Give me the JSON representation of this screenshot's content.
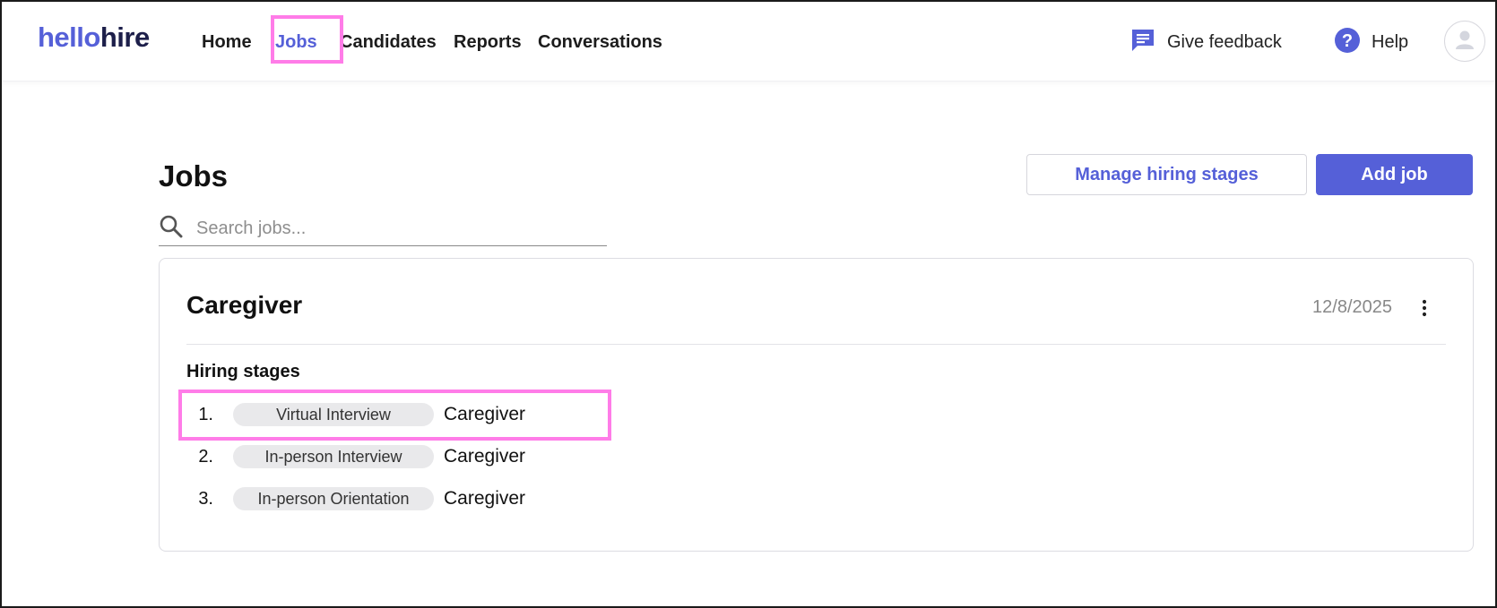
{
  "brand": {
    "part1": "hello",
    "part2": "hire",
    "colors": {
      "primary": "#5560d8",
      "dark": "#1d1f4a"
    }
  },
  "nav": {
    "items": [
      {
        "label": "Home",
        "active": false
      },
      {
        "label": "Jobs",
        "active": true
      },
      {
        "label": "Candidates",
        "active": false
      },
      {
        "label": "Reports",
        "active": false
      },
      {
        "label": "Conversations",
        "active": false
      }
    ],
    "feedback": {
      "label": "Give feedback",
      "icon": "chat-bubble-icon"
    },
    "help": {
      "label": "Help",
      "icon": "question-circle-icon"
    },
    "avatar": {
      "icon": "user-avatar-icon"
    }
  },
  "page": {
    "title": "Jobs",
    "manage_button": "Manage hiring stages",
    "add_button": "Add job",
    "search": {
      "placeholder": "Search jobs...",
      "value": "",
      "icon": "search-icon"
    }
  },
  "jobs": [
    {
      "title": "Caregiver",
      "date": "12/8/2025",
      "menu_icon": "more-vertical-icon",
      "stages_heading": "Hiring stages",
      "stages": [
        {
          "number": "1.",
          "stage": "Virtual Interview",
          "job": "Caregiver"
        },
        {
          "number": "2.",
          "stage": "In-person Interview",
          "job": "Caregiver"
        },
        {
          "number": "3.",
          "stage": "In-person Orientation",
          "job": "Caregiver"
        }
      ]
    }
  ],
  "highlight_color": "#ff7ce8"
}
